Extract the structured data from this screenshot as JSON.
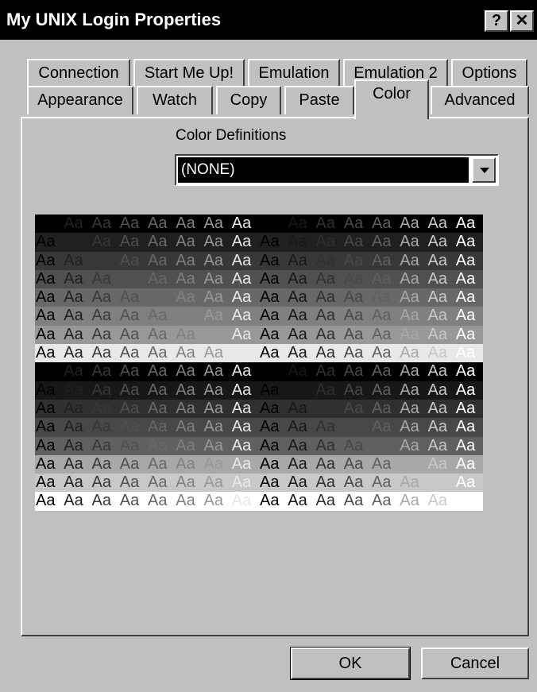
{
  "window": {
    "title": "My UNIX Login Properties",
    "help_label": "?",
    "close_label": "✕"
  },
  "tabs_row1": [
    {
      "label": "Connection"
    },
    {
      "label": "Start Me Up!"
    },
    {
      "label": "Emulation"
    },
    {
      "label": "Emulation 2"
    },
    {
      "label": "Options"
    }
  ],
  "tabs_row2": [
    {
      "label": "Appearance"
    },
    {
      "label": "Watch"
    },
    {
      "label": "Copy"
    },
    {
      "label": "Paste"
    },
    {
      "label": "Color",
      "active": true
    },
    {
      "label": "Advanced"
    }
  ],
  "color_panel": {
    "label": "Color Definitions",
    "select_value": "(NONE)",
    "sample_text": "Aa",
    "palette": [
      "#000000",
      "#202020",
      "#383838",
      "#505050",
      "#686868",
      "#808080",
      "#989898",
      "#e8e8e8",
      "#000000",
      "#181818",
      "#303030",
      "#484848",
      "#606060",
      "#a8a8a8",
      "#c8c8c8",
      "#ffffff"
    ]
  },
  "buttons": {
    "ok": "OK",
    "cancel": "Cancel"
  }
}
